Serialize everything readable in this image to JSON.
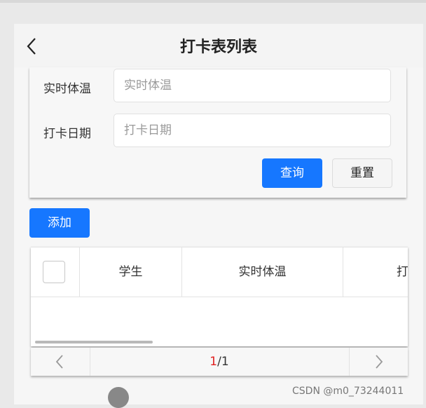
{
  "header": {
    "title": "打卡表列表",
    "back_icon": "chevron-left-icon"
  },
  "search": {
    "temperature_label": "实时体温",
    "temperature_placeholder": "实时体温",
    "date_label": "打卡日期",
    "date_placeholder": "打卡日期",
    "query_label": "查询",
    "reset_label": "重置"
  },
  "toolbar": {
    "add_label": "添加"
  },
  "table": {
    "columns": [
      "学生",
      "实时体温",
      "打"
    ]
  },
  "pagination": {
    "current": "1",
    "separator": "/",
    "total": "1",
    "prev_icon": "chevron-left-icon",
    "next_icon": "chevron-right-icon"
  },
  "watermark": "CSDN @m0_73244011",
  "colors": {
    "primary": "#1677ff",
    "current_page": "#e02020"
  }
}
